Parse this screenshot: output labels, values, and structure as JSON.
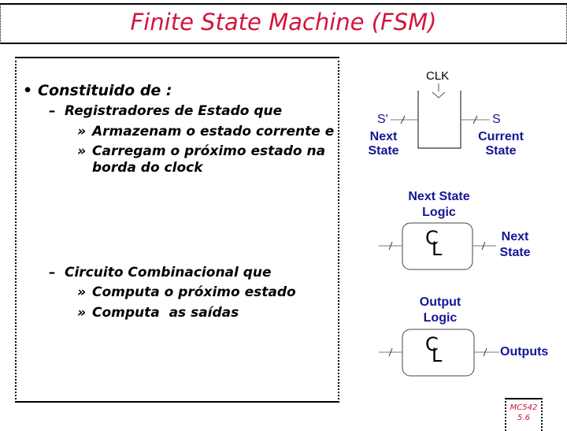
{
  "slide": {
    "title": "Finite State Machine (FSM)",
    "title_color": "#d4143c",
    "bullets": [
      {
        "marker": "•",
        "text": "Constituido de :"
      },
      {
        "marker": "–",
        "text": "Registradores de Estado que"
      },
      {
        "marker": "»",
        "text": "Armazenam o estado corrente e"
      },
      {
        "marker": "»",
        "text": "Carregam o próximo estado na"
      },
      {
        "marker": "",
        "text": "borda do clock"
      },
      {
        "marker": "–",
        "text": "Circuito Combinacional que"
      },
      {
        "marker": "»",
        "text": "Computa o próximo estado"
      },
      {
        "marker": "»",
        "text": "Computa  as saídas"
      }
    ]
  },
  "diagram": {
    "register": {
      "clock_label": "CLK",
      "input_signal": "S'",
      "input_label_line1": "Next",
      "input_label_line2": "State",
      "output_signal": "S",
      "output_label_line1": "Current",
      "output_label_line2": "State"
    },
    "next_state_logic": {
      "title_line1": "Next State",
      "title_line2": "Logic",
      "symbol": "CL",
      "output_line1": "Next",
      "output_line2": "State"
    },
    "output_logic": {
      "title_line1": "Output",
      "title_line2": "Logic",
      "symbol": "CL",
      "output": "Outputs"
    },
    "label_color": "#141496"
  },
  "footer": {
    "course": "MC542",
    "page": "5.6",
    "color": "#c0143c"
  }
}
